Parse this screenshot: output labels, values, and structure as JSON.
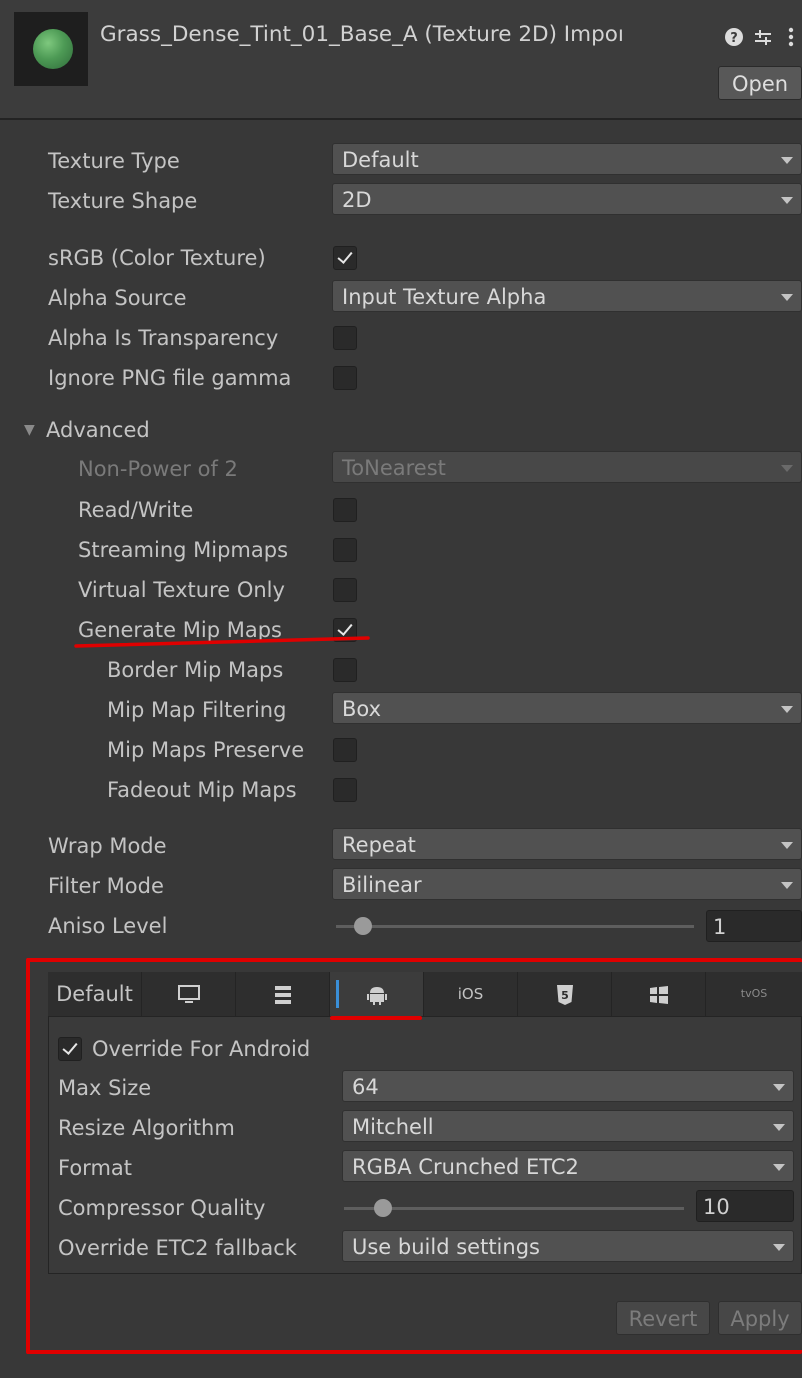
{
  "header": {
    "title": "Grass_Dense_Tint_01_Base_A (Texture 2D) Impoı",
    "open_label": "Open",
    "icons": [
      "help-icon",
      "preset-icon",
      "kebab-menu-icon"
    ]
  },
  "settings": {
    "texture_type": {
      "label": "Texture Type",
      "value": "Default"
    },
    "texture_shape": {
      "label": "Texture Shape",
      "value": "2D"
    },
    "srgb": {
      "label": "sRGB (Color Texture)",
      "checked": true
    },
    "alpha_source": {
      "label": "Alpha Source",
      "value": "Input Texture Alpha"
    },
    "alpha_transparency": {
      "label": "Alpha Is Transparency",
      "checked": false
    },
    "ignore_png_gamma": {
      "label": "Ignore PNG file gamma",
      "checked": false
    }
  },
  "advanced": {
    "label": "Advanced",
    "npot": {
      "label": "Non-Power of 2",
      "value": "ToNearest"
    },
    "read_write": {
      "label": "Read/Write",
      "checked": false
    },
    "streaming_mipmaps": {
      "label": "Streaming Mipmaps",
      "checked": false
    },
    "virtual_texture_only": {
      "label": "Virtual Texture Only",
      "checked": false
    },
    "generate_mip_maps": {
      "label": "Generate Mip Maps",
      "checked": true
    },
    "border_mip_maps": {
      "label": "Border Mip Maps",
      "checked": false
    },
    "mip_map_filtering": {
      "label": "Mip Map Filtering",
      "value": "Box"
    },
    "mip_maps_preserve": {
      "label": "Mip Maps Preserve",
      "checked": false
    },
    "fadeout_mip_maps": {
      "label": "Fadeout Mip Maps",
      "checked": false
    }
  },
  "sampling": {
    "wrap_mode": {
      "label": "Wrap Mode",
      "value": "Repeat"
    },
    "filter_mode": {
      "label": "Filter Mode",
      "value": "Bilinear"
    },
    "aniso_level": {
      "label": "Aniso Level",
      "value": "1"
    }
  },
  "platform": {
    "tabs": [
      {
        "label": "Default",
        "icon": ""
      },
      {
        "label": "",
        "icon": "monitor-icon"
      },
      {
        "label": "",
        "icon": "server-icon"
      },
      {
        "label": "",
        "icon": "android-icon",
        "selected": true
      },
      {
        "label": "iOS",
        "icon": ""
      },
      {
        "label": "",
        "icon": "html5-icon"
      },
      {
        "label": "",
        "icon": "windows-icon"
      },
      {
        "label": "tvOS",
        "icon": ""
      }
    ],
    "override": {
      "label": "Override For Android",
      "checked": true
    },
    "max_size": {
      "label": "Max Size",
      "value": "64"
    },
    "resize_algorithm": {
      "label": "Resize Algorithm",
      "value": "Mitchell"
    },
    "format": {
      "label": "Format",
      "value": "RGBA Crunched ETC2"
    },
    "compressor_quality": {
      "label": "Compressor Quality",
      "value": "10"
    },
    "etc2_fallback": {
      "label": "Override ETC2 fallback",
      "value": "Use build settings"
    }
  },
  "footer": {
    "revert_label": "Revert",
    "apply_label": "Apply"
  },
  "colors": {
    "annotation": "#e00000",
    "background": "#383838",
    "field": "#515151"
  }
}
